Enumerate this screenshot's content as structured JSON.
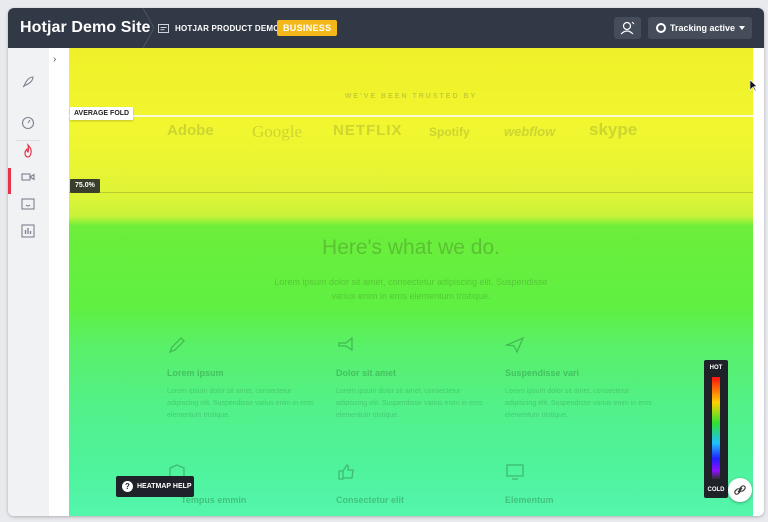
{
  "app": {
    "site_title": "Hotjar Demo Site",
    "project_name": "HOTJAR PRODUCT DEMO",
    "plan_badge": "BUSINESS",
    "tracking_label": "Tracking active"
  },
  "sidebar": {
    "items": [
      {
        "icon": "rocket-icon"
      },
      {
        "icon": "dashboard-icon"
      },
      {
        "icon": "heatmap-icon",
        "active": true
      },
      {
        "icon": "recordings-icon"
      },
      {
        "icon": "feedback-icon"
      },
      {
        "icon": "analytics-icon"
      }
    ],
    "collapse_glyph": "›"
  },
  "heatmap": {
    "average_fold_label": "AVERAGE FOLD",
    "scroll_percent_label": "75.0%",
    "legend_hot": "HOT",
    "legend_cold": "COLD",
    "help_label": "HEATMAP HELP"
  },
  "page_content": {
    "trusted_by": "WE'VE BEEN TRUSTED BY",
    "logos": [
      "Adobe",
      "Google",
      "NETFLIX",
      "Spotify",
      "webflow",
      "skype"
    ],
    "headline": "Here's what we do.",
    "subtitle": "Lorem ipsum dolor sit amet, consectetur adipiscing elit. Suspendisse varius enim in eros elementum tristique.",
    "features": [
      {
        "title": "Lorem ipsum",
        "body": "Lorem ipsum dolor sit amet, consectetur adipiscing elit. Suspendisse varius enim in eros elementum tristique."
      },
      {
        "title": "Dolor sit amet",
        "body": "Lorem ipsum dolor sit amet, consectetur adipiscing elit. Suspendisse varius enim in eros elementum tristique."
      },
      {
        "title": "Suspendisse vari",
        "body": "Lorem ipsum dolor sit amet, consectetur adipiscing elit. Suspendisse varius enim in eros elementum tristique."
      },
      {
        "title": "Tempus emmin",
        "body": ""
      },
      {
        "title": "Consectetur elit",
        "body": ""
      },
      {
        "title": "Elementum",
        "body": ""
      }
    ]
  },
  "colors": {
    "topbar": "#323946",
    "badge": "#f4b81a",
    "active_accent": "#e5344b"
  }
}
